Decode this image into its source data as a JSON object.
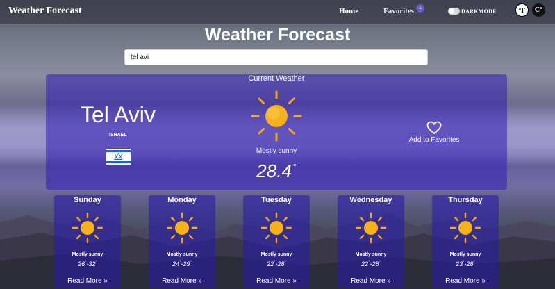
{
  "navbar": {
    "brand": "Weather Forecast",
    "home_label": "Home",
    "favorites_label": "Favorites",
    "favorites_count": "1",
    "darkmode_label": "DARKMODE",
    "unit_f": "°F",
    "unit_c": "C°"
  },
  "page_title": "Weather Forecast",
  "search": {
    "value": "tel avi"
  },
  "current": {
    "section_label": "Current Weather",
    "city": "Tel Aviv",
    "country": "ISRAEL",
    "condition": "Mostly sunny",
    "temperature": "28.4",
    "degree_symbol": "°",
    "add_favorite_label": "Add to Favorites",
    "icon": "sun-icon"
  },
  "forecast": [
    {
      "day": "Sunday",
      "condition": "Mostly sunny",
      "low": "26",
      "high": "32",
      "read_more": "Read More »"
    },
    {
      "day": "Monday",
      "condition": "Mostly sunny",
      "low": "24",
      "high": "29",
      "read_more": "Read More »"
    },
    {
      "day": "Tuesday",
      "condition": "Mostly sunny",
      "low": "22",
      "high": "28",
      "read_more": "Read More »"
    },
    {
      "day": "Wednesday",
      "condition": "Mostly sunny",
      "low": "22",
      "high": "28",
      "read_more": "Read More »"
    },
    {
      "day": "Thursday",
      "condition": "Mostly sunny",
      "low": "23",
      "high": "28",
      "read_more": "Read More »"
    }
  ],
  "colors": {
    "card": "#3a1fb4",
    "sun_core": "#f6b21b",
    "sun_rays": "#f2a91a",
    "flag_blue": "#1f5fd6"
  }
}
